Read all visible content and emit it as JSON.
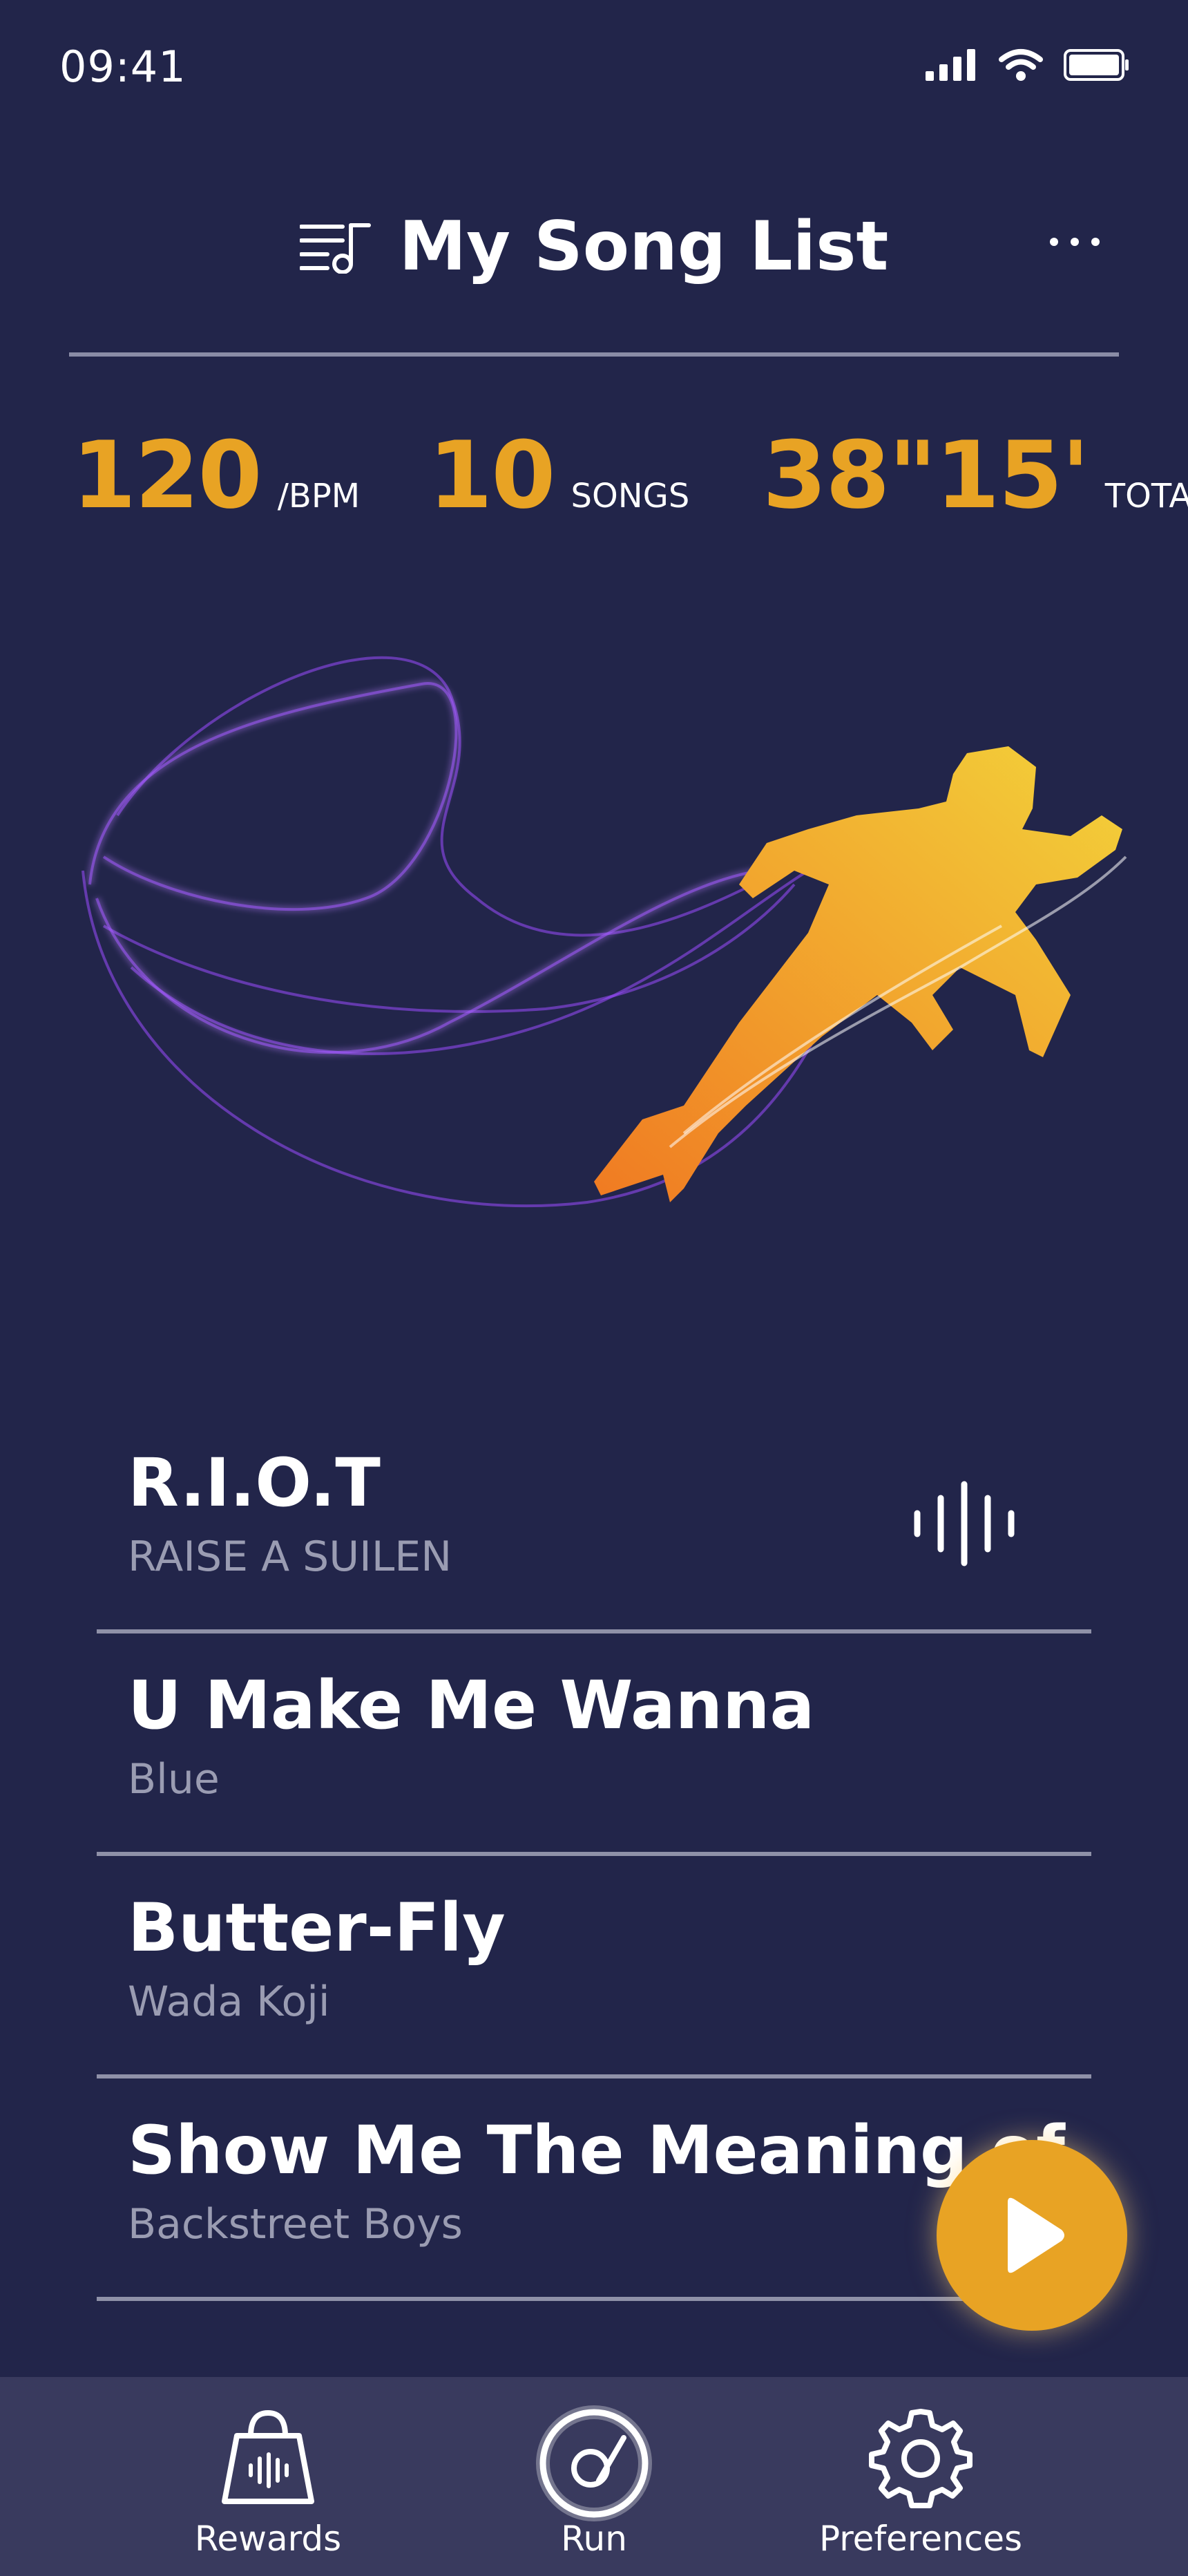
{
  "status_bar": {
    "time": "09:41"
  },
  "header": {
    "title": "My Song List"
  },
  "stats": {
    "bpm_value": "120",
    "bpm_unit": "/BPM",
    "songs_value": "10",
    "songs_unit": "SONGS",
    "total_value": "38\"15'",
    "total_unit": "TOTAL"
  },
  "songs": [
    {
      "title": "R.I.O.T",
      "artist": "RAISE A SUILEN"
    },
    {
      "title": "U Make Me Wanna",
      "artist": "Blue"
    },
    {
      "title": "Butter-Fly",
      "artist": "Wada Koji"
    },
    {
      "title": "Show Me The Meaning of",
      "artist": "Backstreet Boys"
    }
  ],
  "tabs": [
    {
      "label": "Rewards",
      "icon": "shopping-bag-icon"
    },
    {
      "label": "Run",
      "icon": "run-disc-icon"
    },
    {
      "label": "Preferences",
      "icon": "gear-icon"
    }
  ],
  "colors": {
    "background": "#22254a",
    "accent": "#e8a324",
    "tabbar": "#393a5e",
    "wave": "#9b4dff"
  }
}
